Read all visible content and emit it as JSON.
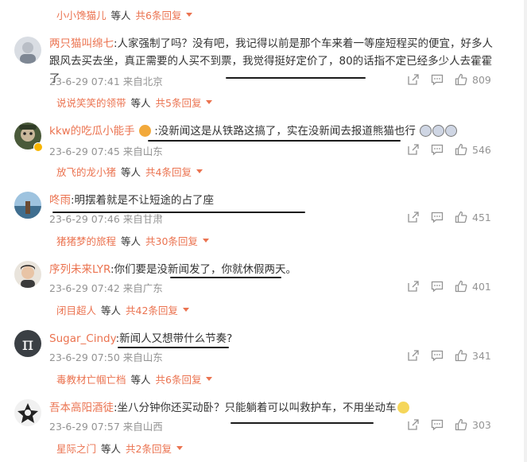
{
  "reply_more_label": "等人",
  "comments": [
    {
      "user": "两只猫叫绵七",
      "text": ":人家强制了吗？没有吧，我记得以前是那个车来着一等座短程买的便宜，好多人跟风去买去坐，真正需要的人买不到票，我觉得挺好定价了，80的话指不定已经多少人去霍霍了",
      "time": "23-6-29 07:41",
      "location": "来自北京",
      "likes": "809",
      "reply_user": "说说笑笑的领带",
      "reply_count": "共5条回复"
    },
    {
      "user": "kkw的吃瓜小能手",
      "text": ":没新闻这是从铁路这搞了，实在没新闻去报道熊猫也行",
      "time": "23-6-29 07:45",
      "location": "来自山东",
      "likes": "546",
      "reply_user": "放飞的龙小猪",
      "reply_count": "共4条回复"
    },
    {
      "user": "咚雨",
      "text": ":明摆着就是不让短途的占了座",
      "time": "23-6-29 07:46",
      "location": "来自甘肃",
      "likes": "451",
      "reply_user": "猪猪梦的旅程",
      "reply_count": "共30条回复"
    },
    {
      "user": "序列未来LYR",
      "text": ":你们要是没新闻发了，你就休假两天。",
      "time": "23-6-29 07:42",
      "location": "来自广东",
      "likes": "401",
      "reply_user": "闭目超人",
      "reply_count": "共42条回复"
    },
    {
      "user": "Sugar_Cindy",
      "text": ":新闻人又想带什么节奏?",
      "time": "23-6-29 07:50",
      "location": "来自山东",
      "likes": "341",
      "reply_user": "毒教材亡帼亡档",
      "reply_count": "共6条回复"
    },
    {
      "user": "吾本高阳酒徒",
      "text": ":坐八分钟你还买动卧？只能躺着可以叫救护车，不用坐动车",
      "time": "23-6-29 07:57",
      "location": "来自山西",
      "likes": "303",
      "reply_user": "星际之门",
      "reply_count": "共2条回复"
    }
  ],
  "top_reply": {
    "user": "小小馋猫儿",
    "count": "共6条回复"
  },
  "colors": {
    "accent": "#eb7350",
    "meta": "#939393",
    "text": "#333333"
  }
}
